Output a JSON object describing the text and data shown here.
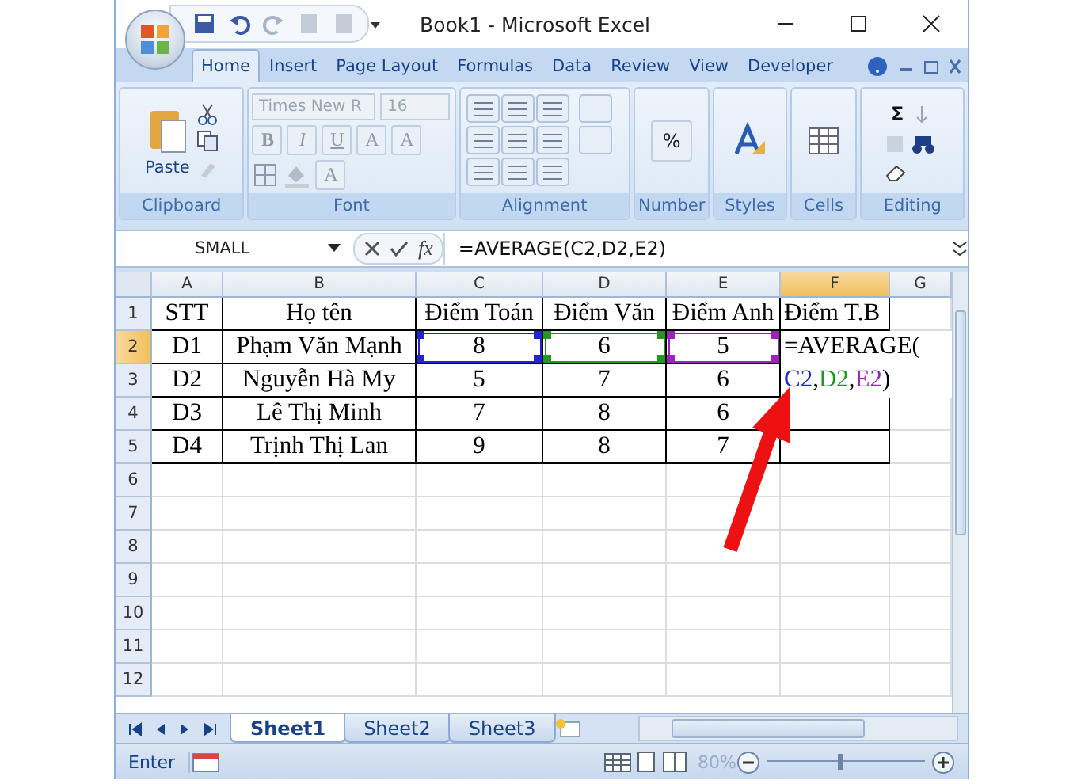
{
  "window": {
    "title": "Book1 - Microsoft Excel"
  },
  "ribbon_tabs": [
    {
      "label": "Home",
      "selected": true
    },
    {
      "label": "Insert",
      "selected": false
    },
    {
      "label": "Page Layout",
      "selected": false
    },
    {
      "label": "Formulas",
      "selected": false
    },
    {
      "label": "Data",
      "selected": false
    },
    {
      "label": "Review",
      "selected": false
    },
    {
      "label": "View",
      "selected": false
    },
    {
      "label": "Developer",
      "selected": false
    }
  ],
  "ribbon": {
    "clipboard": {
      "label": "Clipboard",
      "paste": "Paste"
    },
    "font": {
      "label": "Font",
      "font_name": "Times New R",
      "font_size": "16",
      "style_buttons": [
        "B",
        "I",
        "U"
      ],
      "size_buttons": [
        "A",
        "A"
      ],
      "color_button": "A"
    },
    "alignment": {
      "label": "Alignment"
    },
    "number": {
      "label": "Number",
      "symbol": "%"
    },
    "styles": {
      "label": "Styles"
    },
    "cells": {
      "label": "Cells"
    },
    "editing": {
      "label": "Editing",
      "sum_symbol": "Σ"
    }
  },
  "formula_bar": {
    "name_box": "SMALL",
    "fx": "fx",
    "formula": "=AVERAGE(C2,D2,E2)"
  },
  "columns": [
    {
      "label": "A",
      "selected": false
    },
    {
      "label": "B",
      "selected": false
    },
    {
      "label": "C",
      "selected": false
    },
    {
      "label": "D",
      "selected": false
    },
    {
      "label": "E",
      "selected": false
    },
    {
      "label": "F",
      "selected": true
    },
    {
      "label": "G",
      "selected": false
    }
  ],
  "rows": [
    {
      "number": "1",
      "selected": false,
      "cells": [
        {
          "text": "STT"
        },
        {
          "text": "Họ tên"
        },
        {
          "text": "Điểm Toán"
        },
        {
          "text": "Điểm Văn"
        },
        {
          "text": "Điểm Anh"
        },
        {
          "text": "Điểm T.B"
        }
      ]
    },
    {
      "number": "2",
      "selected": true,
      "cells": [
        {
          "text": "D1"
        },
        {
          "text": "Phạm Văn Mạnh"
        },
        {
          "text": "8",
          "color": "#2323d6"
        },
        {
          "text": "6",
          "color": "#1f9a1f"
        },
        {
          "text": "5",
          "color": "#a020c0"
        },
        {
          "text": "=AVERAGE(",
          "editing": true
        }
      ]
    },
    {
      "number": "3",
      "selected": false,
      "cells": [
        {
          "text": "D2"
        },
        {
          "text": "Nguyễn Hà My"
        },
        {
          "text": "5"
        },
        {
          "text": "7"
        },
        {
          "text": "6"
        },
        {
          "parts": [
            {
              "text": "C2",
              "color": "#2323d6"
            },
            {
              "text": ",",
              "color": "#000000"
            },
            {
              "text": "D2",
              "color": "#1f9a1f"
            },
            {
              "text": ",",
              "color": "#000000"
            },
            {
              "text": "E2",
              "color": "#a020c0"
            },
            {
              "text": ")",
              "color": "#000000"
            }
          ]
        }
      ]
    },
    {
      "number": "4",
      "selected": false,
      "cells": [
        {
          "text": "D3"
        },
        {
          "text": "Lê Thị Minh"
        },
        {
          "text": "7"
        },
        {
          "text": "8"
        },
        {
          "text": "6"
        },
        {
          "text": ""
        }
      ]
    },
    {
      "number": "5",
      "selected": false,
      "cells": [
        {
          "text": "D4"
        },
        {
          "text": "Trịnh Thị Lan"
        },
        {
          "text": "9"
        },
        {
          "text": "8"
        },
        {
          "text": "7"
        },
        {
          "text": ""
        }
      ]
    },
    {
      "number": "6",
      "selected": false
    },
    {
      "number": "7",
      "selected": false
    },
    {
      "number": "8",
      "selected": false
    },
    {
      "number": "9",
      "selected": false
    },
    {
      "number": "10",
      "selected": false
    },
    {
      "number": "11",
      "selected": false
    },
    {
      "number": "12",
      "selected": false
    }
  ],
  "sheet_tabs": [
    {
      "label": "Sheet1",
      "selected": true
    },
    {
      "label": "Sheet2",
      "selected": false
    },
    {
      "label": "Sheet3",
      "selected": false
    }
  ],
  "status_bar": {
    "mode": "Enter",
    "zoom": "80%",
    "level": 0.45
  }
}
